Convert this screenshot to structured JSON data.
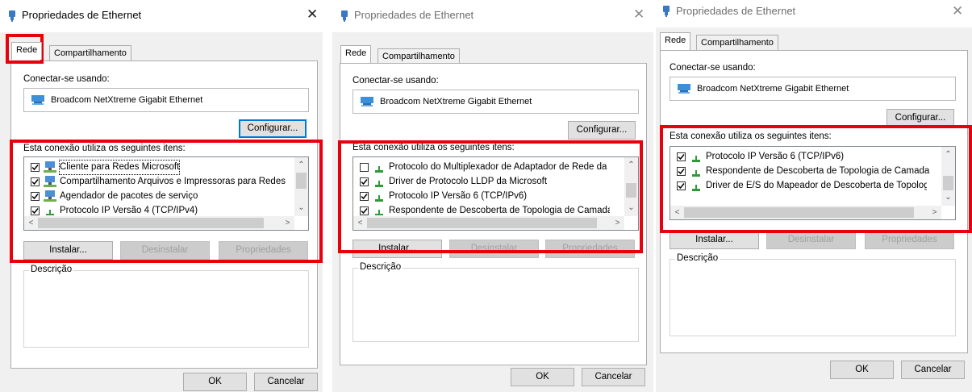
{
  "dialog": {
    "title": "Propriedades de Ethernet",
    "close_symbol": "✕",
    "tabs": {
      "rede": "Rede",
      "compartilhamento": "Compartilhamento"
    },
    "connect_using_label": "Conectar-se usando:",
    "adapter_name": "Broadcom NetXtreme Gigabit Ethernet",
    "configure_button": "Configurar...",
    "items_label": "Esta conexão utiliza os seguintes itens:",
    "install_button": "Instalar...",
    "uninstall_button": "Desinstalar",
    "properties_button": "Propriedades",
    "description_label": "Descrição",
    "ok_button": "OK",
    "cancel_button": "Cancelar"
  },
  "panel1": {
    "items": [
      {
        "label": "Cliente para Redes Microsoft",
        "checked": true,
        "icon": "network-client-icon"
      },
      {
        "label": "Compartilhamento Arquivos e Impressoras para Redes",
        "checked": true,
        "icon": "network-client-icon"
      },
      {
        "label": "Agendador de pacotes de serviço",
        "checked": true,
        "icon": "network-client-icon"
      },
      {
        "label": "Protocolo IP Versão 4 (TCP/IPv4)",
        "checked": true,
        "icon": "protocol-icon"
      }
    ]
  },
  "panel2": {
    "items": [
      {
        "label": "Protocolo do Multiplexador de Adaptador de Rede da M",
        "checked": false,
        "icon": "protocol-icon"
      },
      {
        "label": "Driver de Protocolo LLDP da Microsoft",
        "checked": true,
        "icon": "protocol-icon"
      },
      {
        "label": "Protocolo IP Versão 6 (TCP/IPv6)",
        "checked": true,
        "icon": "protocol-icon"
      },
      {
        "label": "Respondente de Descoberta de Topologia de Camada",
        "checked": true,
        "icon": "protocol-icon"
      }
    ]
  },
  "panel3": {
    "items": [
      {
        "label": "Protocolo IP Versão 6 (TCP/IPv6)",
        "checked": true,
        "icon": "protocol-icon"
      },
      {
        "label": "Respondente de Descoberta de Topologia de Camada",
        "checked": true,
        "icon": "protocol-icon"
      },
      {
        "label": "Driver de E/S do Mapeador de Descoberta de Topolog",
        "checked": true,
        "icon": "protocol-icon"
      }
    ]
  },
  "colors": {
    "highlight_box": "#e8000c",
    "focus_border": "#0078d7"
  }
}
